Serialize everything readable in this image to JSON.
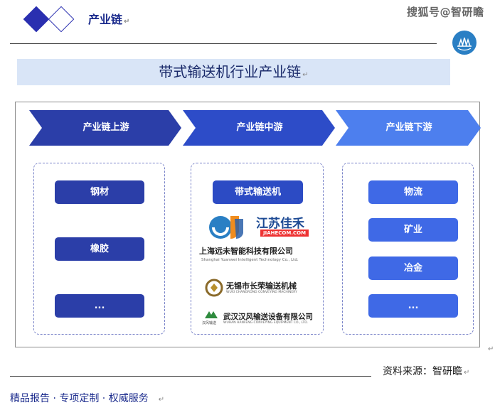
{
  "header": {
    "section_title": "产业链",
    "watermark": "搜狐号@智研瞻",
    "logo_icon": "zhiyanzhan-logo-icon",
    "accent_color": "#2a2fb0"
  },
  "title": "带式输送机行业产业链",
  "stages": [
    {
      "label": "产业链上游",
      "color": "#2b3ea8"
    },
    {
      "label": "产业链中游",
      "color": "#2d4cc8"
    },
    {
      "label": "产业链下游",
      "color": "#4d7fee"
    }
  ],
  "upstream": {
    "items": [
      "钢材",
      "橡胶",
      "..."
    ]
  },
  "midstream": {
    "item": "带式输送机",
    "companies": [
      {
        "logo_name": "江苏佳禾",
        "logo_url_text": "JIAHECOM.COM",
        "icon": "jiahe-logo-icon"
      },
      {
        "name_cn": "上海远未智能科技有限公司",
        "name_en": "Shanghai Yuanwei Intelligent Technology Co., Ltd."
      },
      {
        "name_cn": "无锡市长荣输送机械",
        "name_en": "WUXI CHANGRONG CONVEYING MACHINERY",
        "icon": "changrong-logo-icon"
      },
      {
        "name_cn": "武汉汉风输送设备有限公司",
        "name_en": "WUHAN HANFENG CONVEYING EQUIPMENT CO., LTD.",
        "icon_label": "汉风输送",
        "icon": "hanfeng-logo-icon"
      }
    ]
  },
  "downstream": {
    "items": [
      "物流",
      "矿业",
      "冶金",
      "..."
    ]
  },
  "source": "资料来源：智研瞻",
  "footer": "精品报告 · 专项定制 · 权威服务"
}
